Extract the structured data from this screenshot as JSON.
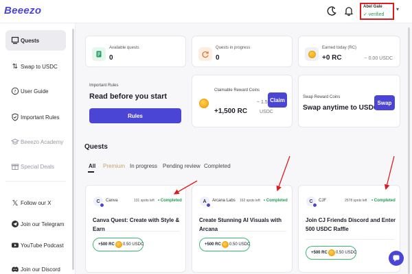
{
  "app": {
    "logo_text": "Beeezo"
  },
  "header": {
    "user_name": "Abel Gale",
    "user_status": "✓ verified"
  },
  "sidebar": {
    "items": [
      {
        "label": "Quests",
        "icon": "monitor-icon"
      },
      {
        "label": "Swap to USDC",
        "icon": "swap-arrows-icon"
      },
      {
        "label": "User Guide",
        "icon": "question-icon"
      },
      {
        "label": "Important Rules",
        "icon": "shield-icon"
      },
      {
        "label": "Beeezo Academy",
        "icon": "graduation-cap-icon"
      },
      {
        "label": "Special Deals",
        "icon": "gift-icon"
      },
      {
        "label": "Follow our X",
        "icon": "x-logo-icon"
      },
      {
        "label": "Join our Telegram",
        "icon": "telegram-icon"
      },
      {
        "label": "YouTube Podcast",
        "icon": "youtube-icon"
      },
      {
        "label": "Join our Discord",
        "icon": "discord-icon"
      }
    ]
  },
  "stats": {
    "available": {
      "label": "Available quests",
      "value": "0"
    },
    "in_progress": {
      "label": "Quests in progress",
      "value": "0"
    },
    "earned": {
      "label": "Earned today (RC)",
      "value": "+0 RC",
      "usdc": "~ 0.00 USDC"
    }
  },
  "rules_card": {
    "small": "Important Rules",
    "big": "Read before you start",
    "button": "Rules"
  },
  "claim_card": {
    "label": "Claimable Reward Coins",
    "sub": "~ 1.50",
    "value": "+1,500 RC",
    "usdc": "USDC",
    "button": "Claim"
  },
  "swap_card": {
    "small": "Swap Reward Coins",
    "big": "Swap anytime to USDC",
    "button": "Swap"
  },
  "quests": {
    "title": "Quests",
    "tabs": [
      "All",
      "Premium",
      "In progress",
      "Pending review",
      "Completed"
    ],
    "cards": [
      {
        "logo": "C",
        "brand": "Canva",
        "spots": "131 spots left",
        "status": "• Completed",
        "title": "Canva Quest: Create with Style & Earn",
        "reward_rc": "+500 RC",
        "reward_usdc": "0.50 USDC"
      },
      {
        "logo": "A",
        "brand": "Arcana Labs",
        "spots": "162 spots left",
        "status": "• Completed",
        "title": "Create Stunning AI Visuals with Arcana",
        "reward_rc": "+500 RC",
        "reward_usdc": "0.50 USDC"
      },
      {
        "logo": "C",
        "brand": "CJF",
        "spots": "2578 spots left",
        "status": "• Completed",
        "title": "Join CJ Friends Discord and Enter 500 USDC Raffle",
        "reward_rc": "+500 RC",
        "reward_usdc": "0.50 USDC"
      }
    ]
  },
  "colors": {
    "brand": "#4b45d6",
    "success": "#1f9d55",
    "highlight": "#e01a1a",
    "premium": "#c9a26b"
  }
}
